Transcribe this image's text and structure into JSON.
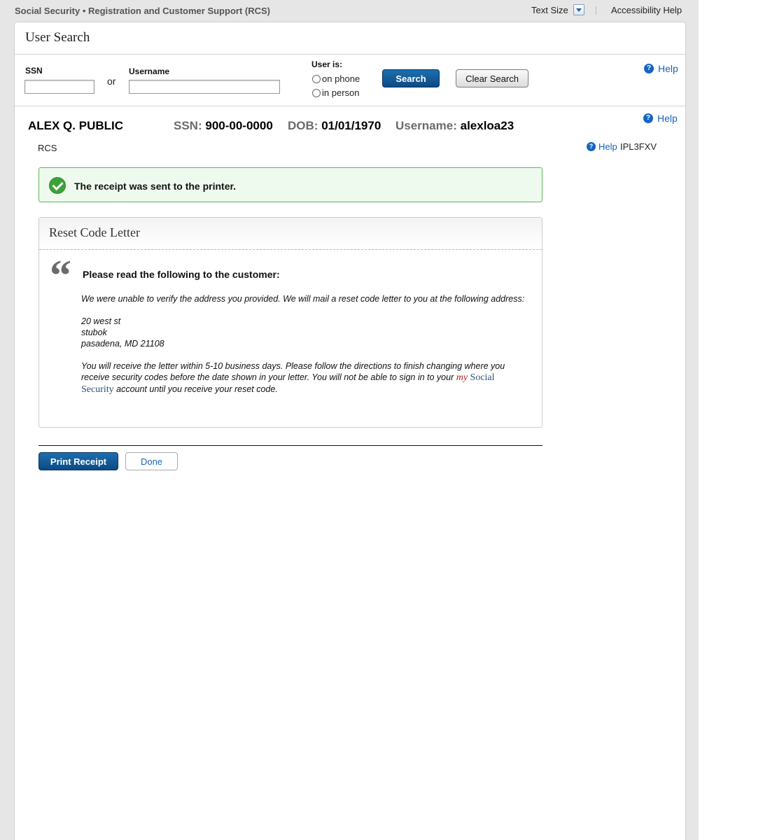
{
  "topbar": {
    "title": "Social Security • Registration and Customer Support (RCS)",
    "text_size_label": "Text Size",
    "accessibility_label": "Accessibility Help"
  },
  "search": {
    "title": "User Search",
    "ssn_label": "SSN",
    "ssn_value": "",
    "or_label": "or",
    "username_label": "Username",
    "username_value": "",
    "user_is_label": "User is:",
    "option_phone": "on phone",
    "option_person": "in person",
    "search_button": "Search",
    "clear_button": "Clear Search",
    "help_label": "Help"
  },
  "customer": {
    "name": "ALEX Q. PUBLIC",
    "ssn_key": "SSN:",
    "ssn": "900-00-0000",
    "dob_key": "DOB:",
    "dob": "01/01/1970",
    "username_key": "Username:",
    "username": "alexloa23",
    "help_label": "Help",
    "rcs_label": "RCS",
    "page_help_label": "Help",
    "page_code": "IPL3FXV"
  },
  "alert": {
    "message": "The receipt was sent to the printer.",
    "color": "#5cb85c"
  },
  "letter": {
    "title": "Reset Code Letter",
    "quote_glyph": "“",
    "lead": "Please read the following to the customer:",
    "para1": "We were unable to verify the address you provided. We will mail a reset code letter to you at the following address:",
    "address_line1": "20 west st",
    "address_line2": "stubok",
    "address_line3": "pasadena, MD 21108",
    "para2_start": "You will receive the letter within 5-10 business days. Please follow the directions to finish changing where you receive security codes before the date shown in your letter. You will not be able to sign in to your ",
    "brand_my": "my",
    "brand_ss": "Social Security",
    "para2_end": " account until you receive your reset code."
  },
  "actions": {
    "print_label": "Print Receipt",
    "done_label": "Done"
  },
  "colors": {
    "primary_button": "#0c4a83",
    "link": "#1a63b8",
    "help_icon": "#1565c0"
  }
}
